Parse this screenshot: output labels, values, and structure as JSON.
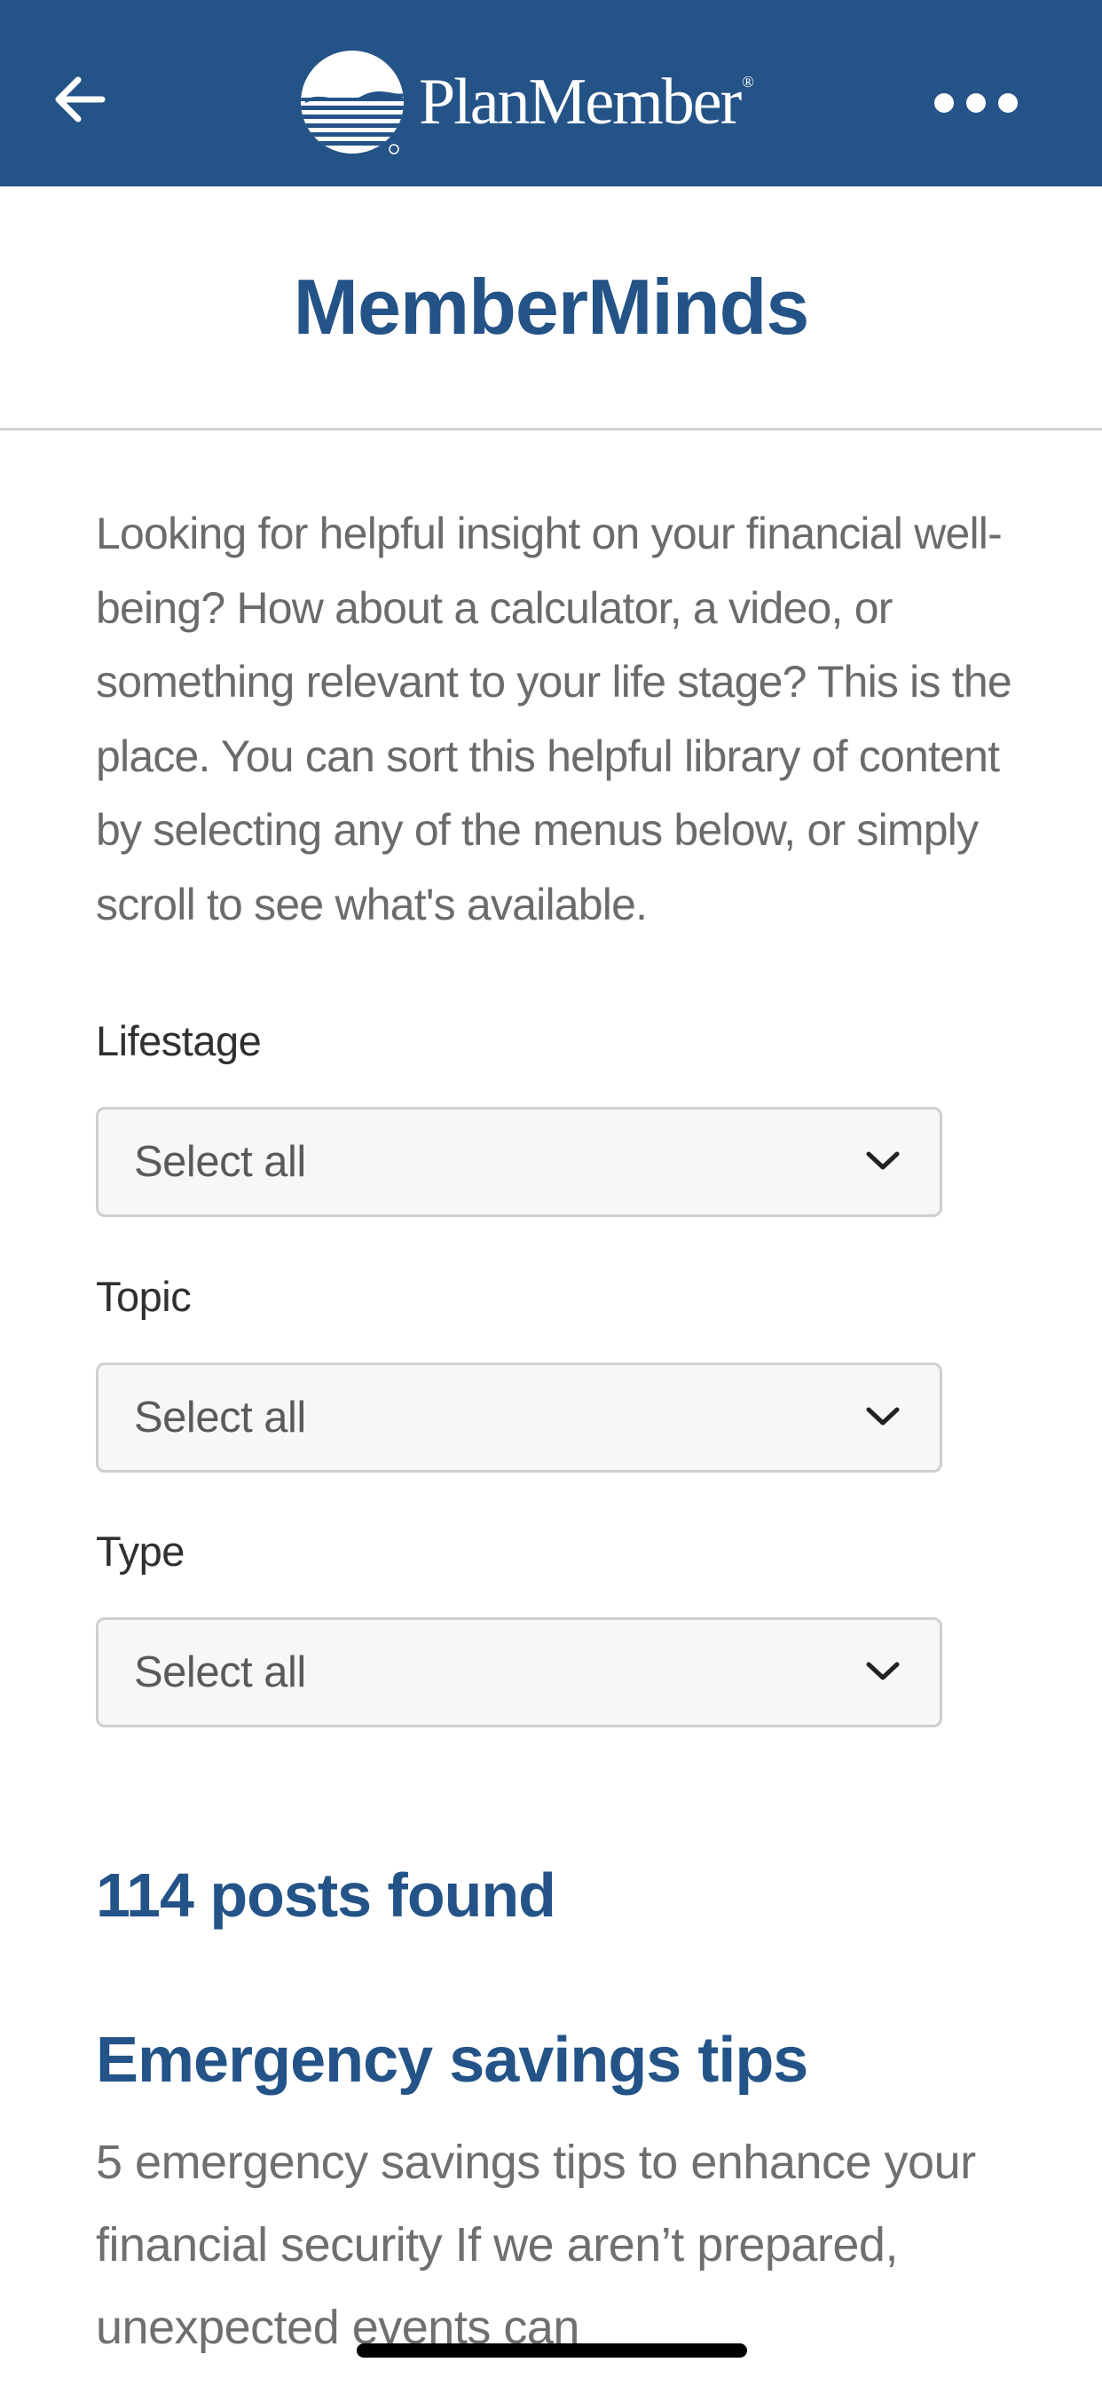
{
  "header": {
    "brand_name": "PlanMember",
    "brand_mark": "®",
    "back_icon": "arrow-left-icon",
    "more_icon": "more-horizontal-icon",
    "background_color": "#245387"
  },
  "page": {
    "title": "MemberMinds",
    "intro": "Looking for helpful insight on your financial well-being? How about a calculator, a video, or something relevant to your life stage? This is the place. You can sort this helpful library of content by selecting any of the menus below, or simply scroll to see what's available."
  },
  "filters": [
    {
      "label": "Lifestage",
      "value": "Select all"
    },
    {
      "label": "Topic",
      "value": "Select all"
    },
    {
      "label": "Type",
      "value": "Select all"
    }
  ],
  "results": {
    "count_text": "114 posts found"
  },
  "posts": [
    {
      "title": "Emergency savings tips",
      "excerpt": "5 emergency savings tips to enhance your financial security If we aren’t prepared, unexpected events can"
    }
  ],
  "colors": {
    "accent": "#245387",
    "body_text": "#6b6b6b",
    "label_text": "#303030"
  }
}
